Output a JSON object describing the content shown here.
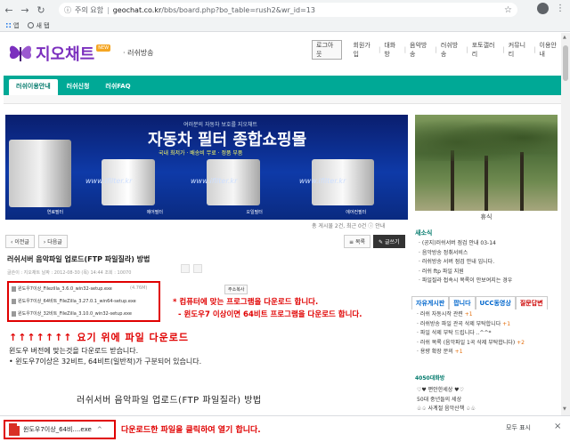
{
  "browser": {
    "security_label": "주의 요함",
    "host": "geochat.co.kr",
    "path": "/bbs/board.php?bo_table=rush2&wr_id=13",
    "bookmarks": [
      {
        "label": "앱",
        "icon": "apps-grid-icon"
      },
      {
        "label": "새 탭",
        "icon": "globe-icon"
      }
    ]
  },
  "site": {
    "logo_text": "지오채트",
    "logo_badge": "NEW",
    "subtitle": "· 러쉬방송",
    "logout": "로그아웃",
    "top_links": [
      "회원가입",
      "대화방",
      "음악방송",
      "러쉬방송",
      "포토갤러리",
      "커뮤니티",
      "이용안내"
    ],
    "tabs": [
      "러쉬이용안내",
      "러쉬신청",
      "러쉬FAQ"
    ]
  },
  "banner": {
    "top_text": "여러분의 자동차 보호를 지오채트",
    "title": "자동차 필터 종합쇼핑몰",
    "subtitle": "국내 최저가 · 배송비 무료 · 정품 부품",
    "urls": [
      "www.ifilter.kr",
      "www.ifilter.kr",
      "www.ifilter.kr"
    ],
    "labels": [
      "연료필터",
      "에어필터",
      "오일필터",
      "에어컨필터"
    ]
  },
  "photo": {
    "caption": "휴식"
  },
  "board": {
    "post_count": "총 게시물 2건, 최근 0건",
    "info_label": "안내",
    "prev_button": "이전글",
    "next_button": "다음글",
    "list_button": "목록",
    "write_button": "글쓰기",
    "post_title": "러쉬서버 음악파일 업로드(FTP 파일질라) 방법",
    "meta": "글쓴이 : 지오채트 날짜 : 2012-08-30 (목) 14:44   조회 : 10070",
    "attachments": [
      "윈도우7이상_Filezilla_3.6.0_win32-setup.exe",
      "윈도우7이상_64비트_FileZilla_3.27.0.1_win64-setup.exe",
      "윈도우7이상_32비트_FileZilla_3.10.0_win32-setup.exe"
    ],
    "attachment_size": "(4.76M)",
    "copy_button": "주소복사",
    "note1": "* 컴퓨터에 맞는 프로그램을 다운로드 합니다.",
    "note2": "- 윈도우7 이상이면 64비트 프로그램을 다운로드 합니다.",
    "arrows_text": "↑↑↑↑↑↑↑ 요기 위에 파일 다운로드",
    "body_line1": "윈도우 버전에 맞는것을 다운로드 받습니다.",
    "body_line2": "• 윈도우7이상은 32비트, 64비트(일반적)가 구분되어 있습니다.",
    "body_big": "러쉬서버 음악파일 업로드(FTP 파일질라) 방법"
  },
  "sidebar": {
    "notice_title": "새소식",
    "notices": [
      "· (공지)러쉬서버 점검 안내 03-14",
      "· 음악방송 정취서비스",
      "· 러쉬방송 서버 점검 안내 입니다.",
      "· 러쉬 ftp 파일 지원",
      "· 파일질라 접속시 목록이 안보여지는 경우"
    ],
    "tabs": [
      "자유게시판",
      "팝니다",
      "UCC동영상",
      "질문답변"
    ],
    "posts": [
      {
        "text": "· 러쉬 자동시작 관련",
        "count": "+1"
      },
      {
        "text": "· 러쉬방송 파일 관곡 삭제 부탁합니다",
        "count": "+1"
      },
      {
        "text": "· 파일 삭제 부탁 드립니다 ..^^*",
        "count": ""
      },
      {
        "text": "· 러쉬 목록 (음악파일 1곡 삭제 부탁합니다)",
        "count": "+2"
      },
      {
        "text": "· 용량 확장 문의",
        "count": "+1"
      }
    ],
    "bottom_title": "4050대화방",
    "bottom_list": [
      "♡♥ 편안한세상 ♥♡",
      "50대 중년들의 세상",
      "♧♤ 사계절 음악산책 ♤♧"
    ]
  },
  "download": {
    "file_name": "윈도우7이상_64비....exe",
    "message": "다운로드한 파일을 클릭하여 열기 합니다.",
    "show_all": "모두 표시"
  }
}
